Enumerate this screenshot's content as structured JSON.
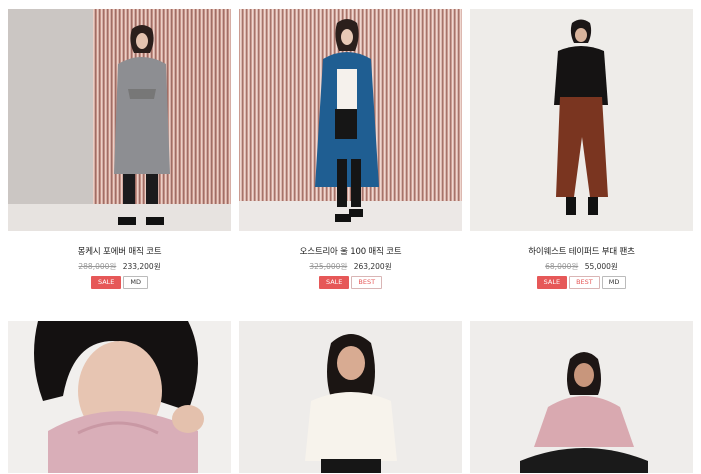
{
  "products": [
    {
      "name": "몽케시 포에버 매직 코트",
      "old_price": "288,000원",
      "price": "233,200원",
      "badges": [
        "SALE",
        "MD"
      ]
    },
    {
      "name": "오스트리아 울 100 매직 코트",
      "old_price": "325,000원",
      "price": "263,200원",
      "badges": [
        "SALE",
        "BEST"
      ]
    },
    {
      "name": "하이웨스트 테이퍼드 부대 팬츠",
      "old_price": "68,000원",
      "price": "55,000원",
      "badges": [
        "SALE",
        "BEST",
        "MD"
      ]
    },
    {
      "name": "",
      "old_price": "",
      "price": "",
      "badges": []
    },
    {
      "name": "",
      "old_price": "",
      "price": "",
      "badges": []
    },
    {
      "name": "",
      "old_price": "",
      "price": "",
      "badges": []
    }
  ],
  "colors": {
    "sale": "#e65858",
    "best_text": "#e65858",
    "tinsel": "#c9948c"
  }
}
